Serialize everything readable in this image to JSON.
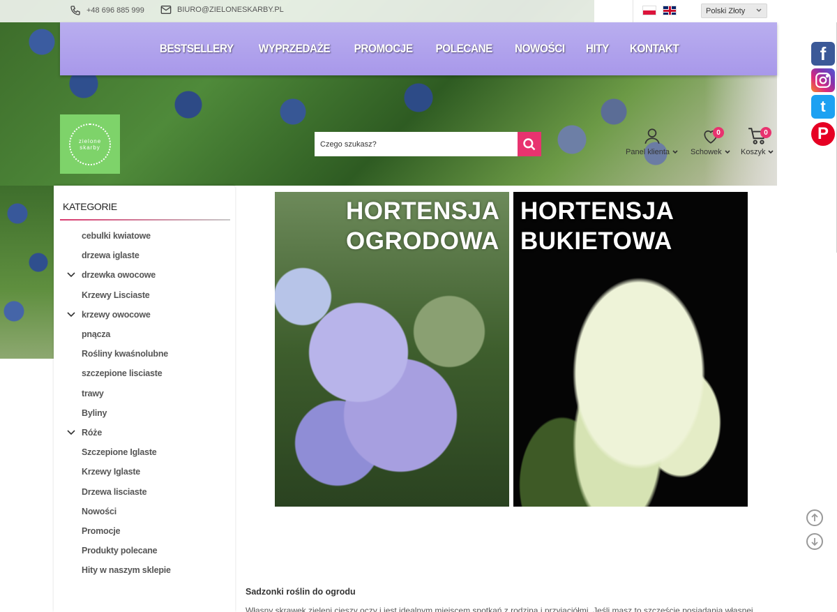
{
  "contact": {
    "phone": "+48 696 885 999",
    "email": "BIURO@ZIELONESKARBY.PL"
  },
  "currency": {
    "selected": "Polski Złoty"
  },
  "nav": {
    "items": [
      "BESTSELLERY",
      "WYPRZEDAŻE",
      "PROMOCJE",
      "POLECANE",
      "NOWOŚCI",
      "HITY",
      "KONTAKT"
    ]
  },
  "logo": {
    "line1": "zielone",
    "line2": "skarby"
  },
  "search": {
    "placeholder": "Czego szukasz?"
  },
  "header": {
    "account_label": "Panel klienta",
    "wishlist_label": "Schowek",
    "wishlist_count": "0",
    "cart_label": "Koszyk",
    "cart_count": "0"
  },
  "sidebar": {
    "title": "KATEGORIE",
    "items": [
      {
        "label": "cebulki kwiatowe",
        "expandable": false
      },
      {
        "label": "drzewa iglaste",
        "expandable": false
      },
      {
        "label": "drzewka owocowe",
        "expandable": true
      },
      {
        "label": "Krzewy Lisciaste",
        "expandable": false
      },
      {
        "label": "krzewy owocowe",
        "expandable": true
      },
      {
        "label": "pnącza",
        "expandable": false
      },
      {
        "label": "Rośliny kwaśnolubne",
        "expandable": false
      },
      {
        "label": "szczepione lisciaste",
        "expandable": false
      },
      {
        "label": "trawy",
        "expandable": false
      },
      {
        "label": "Byliny",
        "expandable": false
      },
      {
        "label": "Róże",
        "expandable": true
      },
      {
        "label": "Szczepione Iglaste",
        "expandable": false
      },
      {
        "label": "Krzewy Iglaste",
        "expandable": false
      },
      {
        "label": "Drzewa lisciaste",
        "expandable": false
      },
      {
        "label": "Nowości",
        "expandable": false
      },
      {
        "label": "Promocje",
        "expandable": false
      },
      {
        "label": "Produkty polecane",
        "expandable": false
      },
      {
        "label": "Hity w naszym sklepie",
        "expandable": false
      }
    ]
  },
  "banners": [
    {
      "line1": "HORTENSJA",
      "line2": "OGRODOWA"
    },
    {
      "line1": "HORTENSJA",
      "line2": "BUKIETOWA"
    }
  ],
  "content": {
    "title": "Sadzonki roślin do ogrodu",
    "paragraph": "Własny skrawek zieleni cieszy oczy i jest idealnym miejscem spotkań z rodziną i przyjaciółmi. Jeśli masz to szczęście posiadania własnej"
  },
  "colors": {
    "nav": "#a898ea",
    "accent": "#e8336f",
    "logo": "#7ed36a"
  }
}
